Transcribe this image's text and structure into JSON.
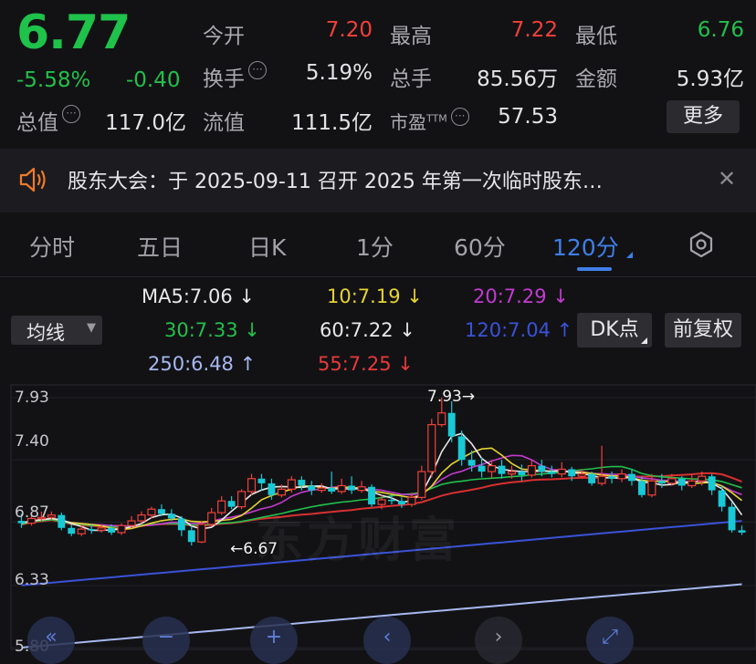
{
  "quote": {
    "price": "6.77",
    "change_pct": "-5.58%",
    "change_abs": "-0.40",
    "open_label": "今开",
    "open_value": "7.20",
    "high_label": "最高",
    "high_value": "7.22",
    "low_label": "最低",
    "low_value": "6.76",
    "turnover_label": "换手",
    "turnover_value": "5.19%",
    "volume_label": "总手",
    "volume_value": "85.56万",
    "amount_label": "金额",
    "amount_value": "5.93亿",
    "mktcap_label": "总值",
    "mktcap_value": "117.0亿",
    "float_label": "流值",
    "float_value": "111.5亿",
    "pe_label": "市盈",
    "pe_sup": "TTM",
    "pe_value": "57.53",
    "more_label": "更多"
  },
  "notice": {
    "text": "股东大会：于 2025-09-11 召开 2025 年第一次临时股东…"
  },
  "tabs": [
    {
      "label": "分时"
    },
    {
      "label": "五日"
    },
    {
      "label": "日K"
    },
    {
      "label": "1分"
    },
    {
      "label": "60分"
    },
    {
      "label": "120分"
    }
  ],
  "ma": {
    "ma5": "MA5:7.06 ↓",
    "ma10": "10:7.19 ↓",
    "ma20": "20:7.29 ↓",
    "ma30": "30:7.33 ↓",
    "ma60": "60:7.22 ↓",
    "ma120": "120:7.04 ↑",
    "ma250": "250:6.48 ↑",
    "ma55": "55:7.25 ↓"
  },
  "controls": {
    "avg_select": "均线",
    "dk_label": "DK点",
    "adjust_label": "前复权"
  },
  "chart_data": {
    "type": "candlestick",
    "y_ticks": [
      "7.93",
      "7.40",
      "6.87",
      "6.33",
      "5.80"
    ],
    "ylim": [
      5.8,
      7.93
    ],
    "max_marker": "7.93",
    "min_marker": "6.67",
    "watermark": "东方财富",
    "colors": {
      "up": "#f0413a",
      "down": "#18c9d6",
      "ma5": "#e8e8e8",
      "ma10": "#e6d430",
      "ma20": "#c33ad0",
      "ma30": "#22c04b",
      "ma60": "#e8e8e8",
      "ma120": "#3a52d8",
      "ma250": "#a7b8f0",
      "ma55": "#d93030"
    },
    "candles": [
      [
        6.88,
        6.86,
        6.94,
        6.82
      ],
      [
        6.86,
        6.9,
        6.94,
        6.84
      ],
      [
        6.9,
        6.91,
        6.96,
        6.88
      ],
      [
        6.91,
        6.93,
        6.96,
        6.89
      ],
      [
        6.93,
        6.82,
        6.95,
        6.8
      ],
      [
        6.82,
        6.77,
        6.85,
        6.75
      ],
      [
        6.77,
        6.81,
        6.85,
        6.75
      ],
      [
        6.81,
        6.8,
        6.85,
        6.77
      ],
      [
        6.8,
        6.82,
        6.85,
        6.78
      ],
      [
        6.82,
        6.78,
        6.85,
        6.76
      ],
      [
        6.78,
        6.84,
        6.86,
        6.76
      ],
      [
        6.84,
        6.88,
        6.92,
        6.82
      ],
      [
        6.88,
        6.93,
        6.96,
        6.86
      ],
      [
        6.93,
        6.98,
        7.0,
        6.9
      ],
      [
        6.98,
        6.94,
        7.02,
        6.92
      ],
      [
        6.94,
        6.9,
        6.98,
        6.88
      ],
      [
        6.9,
        6.8,
        6.92,
        6.75
      ],
      [
        6.8,
        6.7,
        6.84,
        6.67
      ],
      [
        6.7,
        6.85,
        6.88,
        6.69
      ],
      [
        6.85,
        6.95,
        6.99,
        6.83
      ],
      [
        6.95,
        7.05,
        7.09,
        6.93
      ],
      [
        7.05,
        7.0,
        7.09,
        6.98
      ],
      [
        7.0,
        7.13,
        7.15,
        6.98
      ],
      [
        7.13,
        7.24,
        7.28,
        7.1
      ],
      [
        7.24,
        7.2,
        7.28,
        7.14
      ],
      [
        7.2,
        7.1,
        7.24,
        7.06
      ],
      [
        7.1,
        7.15,
        7.19,
        7.08
      ],
      [
        7.15,
        7.23,
        7.26,
        7.12
      ],
      [
        7.23,
        7.18,
        7.26,
        7.14
      ],
      [
        7.18,
        7.14,
        7.22,
        7.1
      ],
      [
        7.14,
        7.16,
        7.2,
        7.12
      ],
      [
        7.16,
        7.13,
        7.3,
        7.11
      ],
      [
        7.13,
        7.18,
        7.24,
        7.11
      ],
      [
        7.18,
        7.14,
        7.26,
        7.11
      ],
      [
        7.14,
        7.17,
        7.22,
        7.12
      ],
      [
        7.17,
        7.02,
        7.19,
        7.0
      ],
      [
        7.02,
        7.06,
        7.1,
        6.98
      ],
      [
        7.06,
        7.05,
        7.1,
        7.02
      ],
      [
        7.05,
        7.02,
        7.08,
        6.99
      ],
      [
        7.02,
        7.08,
        7.12,
        7.0
      ],
      [
        7.08,
        7.3,
        7.35,
        7.06
      ],
      [
        7.3,
        7.7,
        7.75,
        7.25
      ],
      [
        7.7,
        7.8,
        7.93,
        7.68
      ],
      [
        7.8,
        7.6,
        7.9,
        7.55
      ],
      [
        7.6,
        7.4,
        7.65,
        7.35
      ],
      [
        7.4,
        7.35,
        7.48,
        7.3
      ],
      [
        7.35,
        7.3,
        7.42,
        7.25
      ],
      [
        7.3,
        7.35,
        7.4,
        7.25
      ],
      [
        7.35,
        7.28,
        7.4,
        7.24
      ],
      [
        7.28,
        7.3,
        7.35,
        7.24
      ],
      [
        7.3,
        7.27,
        7.36,
        7.22
      ],
      [
        7.27,
        7.35,
        7.4,
        7.25
      ],
      [
        7.35,
        7.3,
        7.4,
        7.26
      ],
      [
        7.3,
        7.28,
        7.35,
        7.25
      ],
      [
        7.28,
        7.32,
        7.38,
        7.25
      ],
      [
        7.32,
        7.26,
        7.34,
        7.22
      ],
      [
        7.26,
        7.28,
        7.32,
        7.24
      ],
      [
        7.28,
        7.2,
        7.3,
        7.18
      ],
      [
        7.2,
        7.26,
        7.52,
        7.18
      ],
      [
        7.26,
        7.24,
        7.3,
        7.2
      ],
      [
        7.24,
        7.28,
        7.32,
        7.21
      ],
      [
        7.28,
        7.22,
        7.32,
        7.18
      ],
      [
        7.22,
        7.1,
        7.26,
        7.08
      ],
      [
        7.1,
        7.22,
        7.28,
        7.08
      ],
      [
        7.22,
        7.2,
        7.28,
        7.16
      ],
      [
        7.2,
        7.24,
        7.28,
        7.18
      ],
      [
        7.24,
        7.18,
        7.26,
        7.14
      ],
      [
        7.18,
        7.22,
        7.28,
        7.16
      ],
      [
        7.22,
        7.26,
        7.3,
        7.18
      ],
      [
        7.26,
        7.14,
        7.28,
        7.1
      ],
      [
        7.14,
        7.0,
        7.18,
        6.96
      ],
      [
        7.0,
        6.8,
        7.04,
        6.78
      ],
      [
        6.8,
        6.78,
        6.84,
        6.76
      ]
    ]
  }
}
